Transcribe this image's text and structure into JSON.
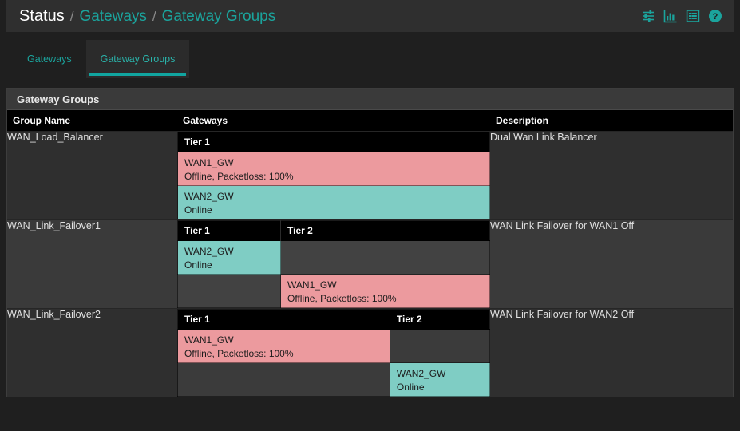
{
  "breadcrumb": {
    "root": "Status",
    "sep": "/",
    "link1": "Gateways",
    "link2": "Gateway Groups"
  },
  "header_icons": [
    {
      "name": "sliders-icon",
      "title": "Filter"
    },
    {
      "name": "bar-chart-icon",
      "title": "Status Monitoring"
    },
    {
      "name": "list-icon",
      "title": "Gateway Groups"
    },
    {
      "name": "help-circle-icon",
      "title": "Help"
    }
  ],
  "tabs": [
    {
      "label": "Gateways",
      "active": false
    },
    {
      "label": "Gateway Groups",
      "active": true
    }
  ],
  "panel": {
    "title": "Gateway Groups",
    "columns": [
      "Group Name",
      "Gateways",
      "Description"
    ],
    "tier_headers": {
      "t1": "Tier 1",
      "t2": "Tier 2"
    },
    "rows": [
      {
        "group_name": "WAN_Load_Balancer",
        "description": "Dual Wan Link Balancer",
        "tiers": [
          "Tier 1"
        ],
        "entries": [
          {
            "tier": 0,
            "gateway": "WAN1_GW",
            "status": "Offline, Packetloss: 100%",
            "state": "offline"
          },
          {
            "tier": 0,
            "gateway": "WAN2_GW",
            "status": "Online",
            "state": "online"
          }
        ]
      },
      {
        "group_name": "WAN_Link_Failover1",
        "description": "WAN Link Failover for WAN1 Off",
        "tiers": [
          "Tier 1",
          "Tier 2"
        ],
        "entries": [
          {
            "tier": 0,
            "gateway": "WAN2_GW",
            "status": "Online",
            "state": "online"
          },
          {
            "tier": 1,
            "gateway": "WAN1_GW",
            "status": "Offline, Packetloss: 100%",
            "state": "offline"
          }
        ]
      },
      {
        "group_name": "WAN_Link_Failover2",
        "description": "WAN Link Failover for WAN2 Off",
        "tiers": [
          "Tier 1",
          "Tier 2"
        ],
        "entries": [
          {
            "tier": 0,
            "gateway": "WAN1_GW",
            "status": "Offline, Packetloss: 100%",
            "state": "offline"
          },
          {
            "tier": 1,
            "gateway": "WAN2_GW",
            "status": "Online",
            "state": "online"
          }
        ]
      }
    ]
  },
  "colors": {
    "accent": "#1ba39c",
    "offline": "#ec9a9e",
    "online": "#7fcdc4",
    "page_bg": "#1f1f1f",
    "panel_bg": "#2f2f2f",
    "row_alt_bg": "#3a3a3a",
    "header_bg": "#000000"
  }
}
